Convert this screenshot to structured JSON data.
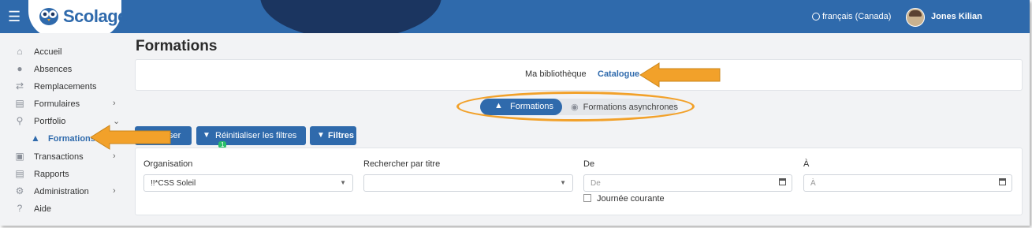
{
  "header": {
    "logo_text": "Scolago",
    "language": "français (Canada)",
    "user_name": "Jones Kilian",
    "brand_color": "#2f6aac"
  },
  "sidebar": {
    "items": [
      {
        "label": "Accueil",
        "icon": "home-icon"
      },
      {
        "label": "Absences",
        "icon": "user-absence-icon"
      },
      {
        "label": "Remplacements",
        "icon": "swap-icon"
      },
      {
        "label": "Formulaires",
        "icon": "document-icon"
      },
      {
        "label": "Portfolio",
        "icon": "trophy-icon"
      },
      {
        "label": "Formations",
        "icon": "graduation-cap-icon"
      },
      {
        "label": "Transactions",
        "icon": "wallet-icon"
      },
      {
        "label": "Rapports",
        "icon": "report-icon"
      },
      {
        "label": "Administration",
        "icon": "gear-icon"
      },
      {
        "label": "Aide",
        "icon": "question-icon"
      }
    ]
  },
  "main": {
    "title": "Formations",
    "library_tabs": {
      "ma_bibliotheque": "Ma bibliothèque",
      "catalogue": "Catalogue"
    },
    "segments": {
      "formations": "Formations",
      "asynchrones": "Formations asynchrones"
    },
    "buttons": {
      "actualiser": "Actualiser",
      "reinitialiser": "Réinitialiser les filtres",
      "reinitialiser_count": "1",
      "filtres": "Filtres"
    },
    "filters": {
      "organisation_label": "Organisation",
      "organisation_value": "!!*CSS Soleil",
      "titre_label": "Rechercher par titre",
      "de_label": "De",
      "de_placeholder": "De",
      "a_label": "À",
      "a_placeholder": "À",
      "journee_courante": "Journée courante"
    }
  },
  "annotation_color": "#f2a12a"
}
